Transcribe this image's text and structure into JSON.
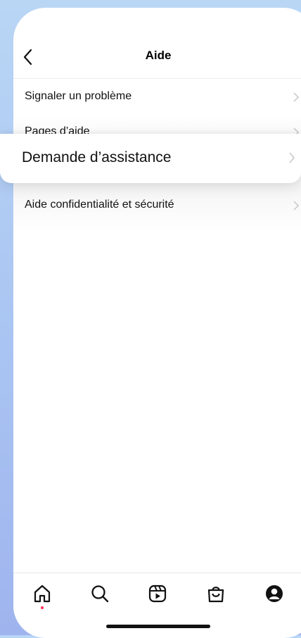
{
  "header": {
    "title": "Aide"
  },
  "menu": {
    "items": [
      {
        "label": "Signaler un problème"
      },
      {
        "label": "Pages d’aide"
      },
      {
        "label": "Demande d’assistance"
      },
      {
        "label": "Aide confidentialité et sécurité"
      }
    ]
  },
  "tabbar": {
    "icons": [
      "home-icon",
      "search-icon",
      "reels-icon",
      "shop-icon",
      "profile-icon"
    ],
    "notification_dot_color": "#ff2d55"
  }
}
